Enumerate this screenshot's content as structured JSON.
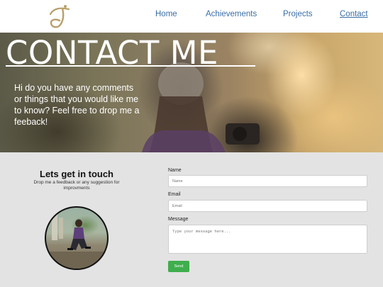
{
  "nav": {
    "logo_icon": "signature-j-logo",
    "items": [
      {
        "label": "Home"
      },
      {
        "label": "Achievements"
      },
      {
        "label": "Projects"
      },
      {
        "label": "Contact",
        "active": true
      }
    ]
  },
  "hero": {
    "title": "CONTACT ME",
    "text": "Hi do you have any comments or things that you would like me to know? Feel free to drop me a feeback!"
  },
  "touch": {
    "title": "Lets get in touch",
    "subtitle": "Drop me a feedback or any suggestion for improvments"
  },
  "form": {
    "name_label": "Name",
    "name_placeholder": "Name",
    "email_label": "Email",
    "email_placeholder": "Email",
    "message_label": "Message",
    "message_placeholder": "Type your message here...",
    "send_label": "Send"
  },
  "colors": {
    "nav_link": "#3a6ea5",
    "send_button": "#3fae4d",
    "logo": "#b8a06a"
  }
}
